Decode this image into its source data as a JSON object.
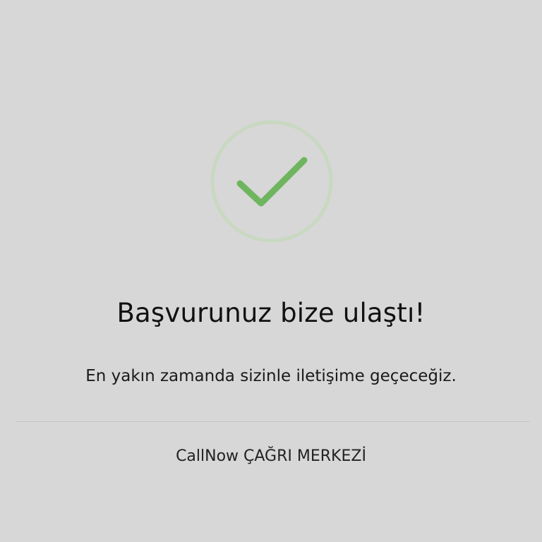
{
  "confirmation": {
    "icon": "check-circle-icon",
    "title": "Başvurunuz bize ulaştı!",
    "message": "En yakın zamanda sizinle iletişime geçeceğiz."
  },
  "footer": {
    "brand": "CallNow ÇAĞRI MERKEZİ"
  },
  "colors": {
    "background": "#d7d7d7",
    "ring": "#c9d8c1",
    "check": "#6fb55f",
    "divider": "#c4c4c4",
    "text": "#111111"
  }
}
